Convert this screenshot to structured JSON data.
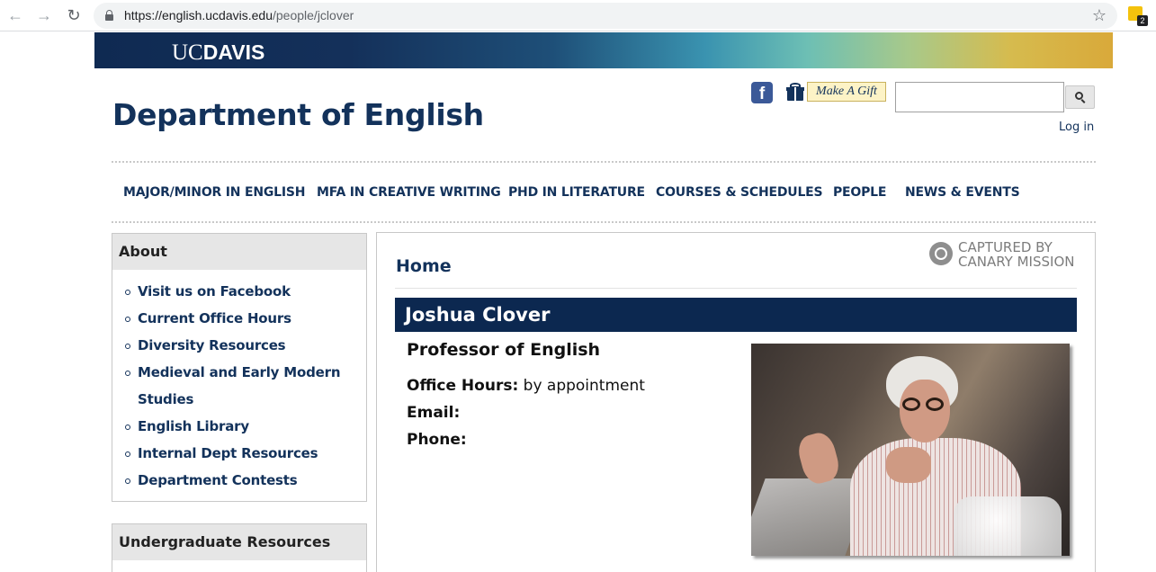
{
  "browser": {
    "url_host": "https://english.ucdavis.edu",
    "url_path": "/people/jclover",
    "extension_badge": "2"
  },
  "banner": {
    "logo_uc": "UC",
    "logo_davis": "DAVIS"
  },
  "header": {
    "site_title": "Department of English",
    "facebook_letter": "f",
    "gift_label": "Make A Gift",
    "search_placeholder": "",
    "login_label": "Log in"
  },
  "nav": {
    "items": [
      "MAJOR/MINOR IN ENGLISH",
      "MFA IN CREATIVE WRITING",
      "PHD IN LITERATURE",
      "COURSES & SCHEDULES",
      "PEOPLE",
      "NEWS & EVENTS"
    ]
  },
  "sidebar": {
    "about_title": "About",
    "about_links": [
      "Visit us on Facebook",
      "Current Office Hours",
      "Diversity Resources",
      "Medieval and Early Modern Studies",
      "English Library",
      "Internal Dept Resources",
      "Department Contests"
    ],
    "undergrad_title": "Undergraduate Resources"
  },
  "content": {
    "breadcrumb": "Home",
    "watermark_line1": "CAPTURED BY",
    "watermark_line2": "CANARY MISSION",
    "name": "Joshua Clover",
    "title": "Professor of English",
    "office_hours_label": "Office Hours:",
    "office_hours_value": "by appointment",
    "email_label": "Email:",
    "phone_label": "Phone:"
  },
  "colors": {
    "brand_navy": "#13325b",
    "name_bar": "#0c2850"
  }
}
